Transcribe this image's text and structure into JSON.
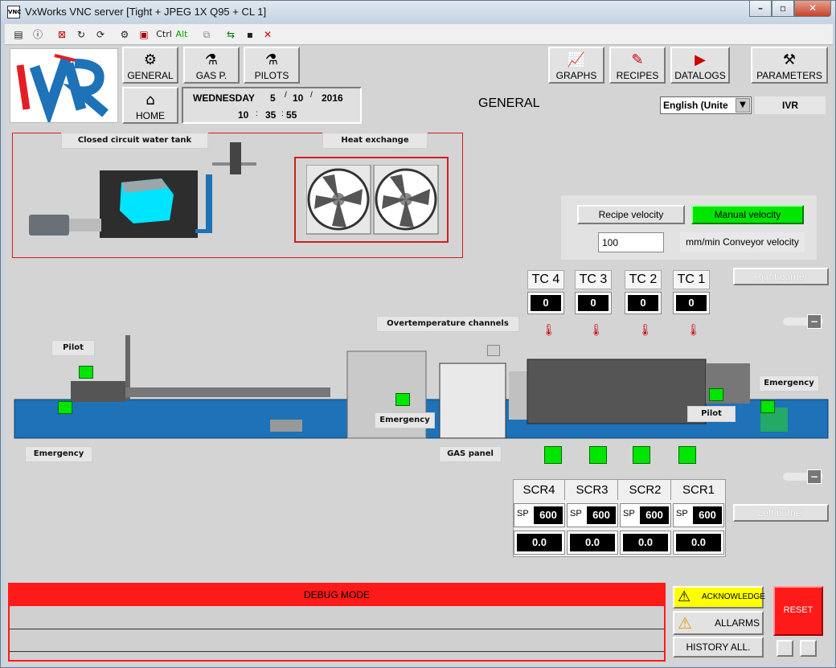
{
  "window": {
    "title": "VxWorks VNC server [Tight + JPEG 1X Q95 + CL 1]",
    "app_icon": "VNC"
  },
  "toolbar": {
    "ctrl": "Ctrl",
    "alt": "Alt"
  },
  "nav": {
    "general": "GENERAL",
    "gas": "GAS P.",
    "pilots": "PILOTS",
    "home": "HOME",
    "graphs": "GRAPHS",
    "recipes": "RECIPES",
    "datalogs": "DATALOGS",
    "parameters": "PARAMETERS"
  },
  "datetime": {
    "day": "WEDNESDAY",
    "d": "5",
    "m": "10",
    "y": "2016",
    "h": "10",
    "min": "35",
    "s": "55",
    "sep_date": "/",
    "sep_time": ":"
  },
  "page_title": "GENERAL",
  "language": {
    "selected": "English (Unite"
  },
  "user": "IVR",
  "logo_text": "IVR",
  "labels": {
    "water_tank": "Closed circuit water tank",
    "heat_exchange": "Heat exchange",
    "overtemp": "Overtemperature channels",
    "pilot_left": "Pilot",
    "pilot_right": "Pilot",
    "emergency_left": "Emergency",
    "emergency_mid": "Emergency",
    "emergency_right": "Emergency",
    "gas_panel": "GAS panel"
  },
  "velocity": {
    "recipe": "Recipe velocity",
    "manual": "Manual velocity",
    "value": "100",
    "unit": "mm/min Conveyor velocity"
  },
  "burners": {
    "right": "Right burner",
    "left": "Left burner"
  },
  "tc": [
    {
      "name": "TC 4",
      "value": "0"
    },
    {
      "name": "TC 3",
      "value": "0"
    },
    {
      "name": "TC 2",
      "value": "0"
    },
    {
      "name": "TC 1",
      "value": "0"
    }
  ],
  "scr": [
    {
      "name": "SCR4",
      "sp_label": "SP",
      "sp": "600",
      "value": "0.0"
    },
    {
      "name": "SCR3",
      "sp_label": "SP",
      "sp": "600",
      "value": "0.0"
    },
    {
      "name": "SCR2",
      "sp_label": "SP",
      "sp": "600",
      "value": "0.0"
    },
    {
      "name": "SCR1",
      "sp_label": "SP",
      "sp": "600",
      "value": "0.0"
    }
  ],
  "debug": {
    "title": "DEBUG MODE"
  },
  "alarms": {
    "acknowledge": "ACKNOWLEDGE",
    "allarms": "ALLARMS",
    "history": "HISTORY ALL.",
    "reset": "RESET"
  },
  "colors": {
    "brand_red": "#e31e24",
    "brand_blue": "#1d72b8",
    "active_green": "#00e600",
    "debug_red": "#ff1a1a",
    "ack_yellow": "#ffff00"
  }
}
